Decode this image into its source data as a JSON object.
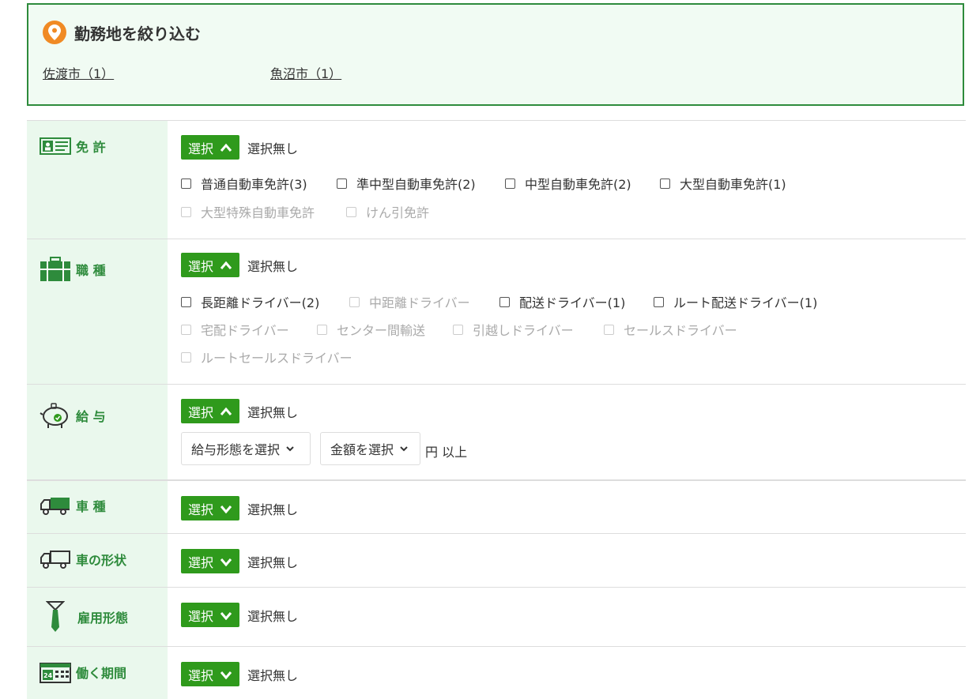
{
  "location": {
    "title": "勤務地を絞り込む",
    "links": [
      "佐渡市（1）",
      "魚沼市（1）"
    ]
  },
  "common": {
    "select_label": "選択",
    "none_label": "選択無し"
  },
  "sections": {
    "license": {
      "label": "免 許",
      "options": [
        "普通自動車免許(3)",
        "準中型自動車免許(2)",
        "中型自動車免許(2)",
        "大型自動車免許(1)",
        "大型特殊自動車免許",
        "けん引免許"
      ]
    },
    "job": {
      "label": "職 種",
      "options": [
        "長距離ドライバー(2)",
        "中距離ドライバー",
        "配送ドライバー(1)",
        "ルート配送ドライバー(1)",
        "宅配ドライバー",
        "センター間輸送",
        "引越しドライバー",
        "セールスドライバー",
        "ルートセールスドライバー"
      ]
    },
    "salary": {
      "label": "給 与",
      "type_select": "給与形態を選択",
      "amount_select": "金額を選択",
      "unit": "円 以上"
    },
    "vehicle": {
      "label": "車 種"
    },
    "shape": {
      "label": "車の形状"
    },
    "employment": {
      "label": "雇用形態"
    },
    "period": {
      "label": "働く期間"
    }
  },
  "colors": {
    "accent": "#2f9a1c",
    "label_green": "#2e8b3c",
    "pin": "#f08a24",
    "side_bg": "#eaf8ed"
  }
}
